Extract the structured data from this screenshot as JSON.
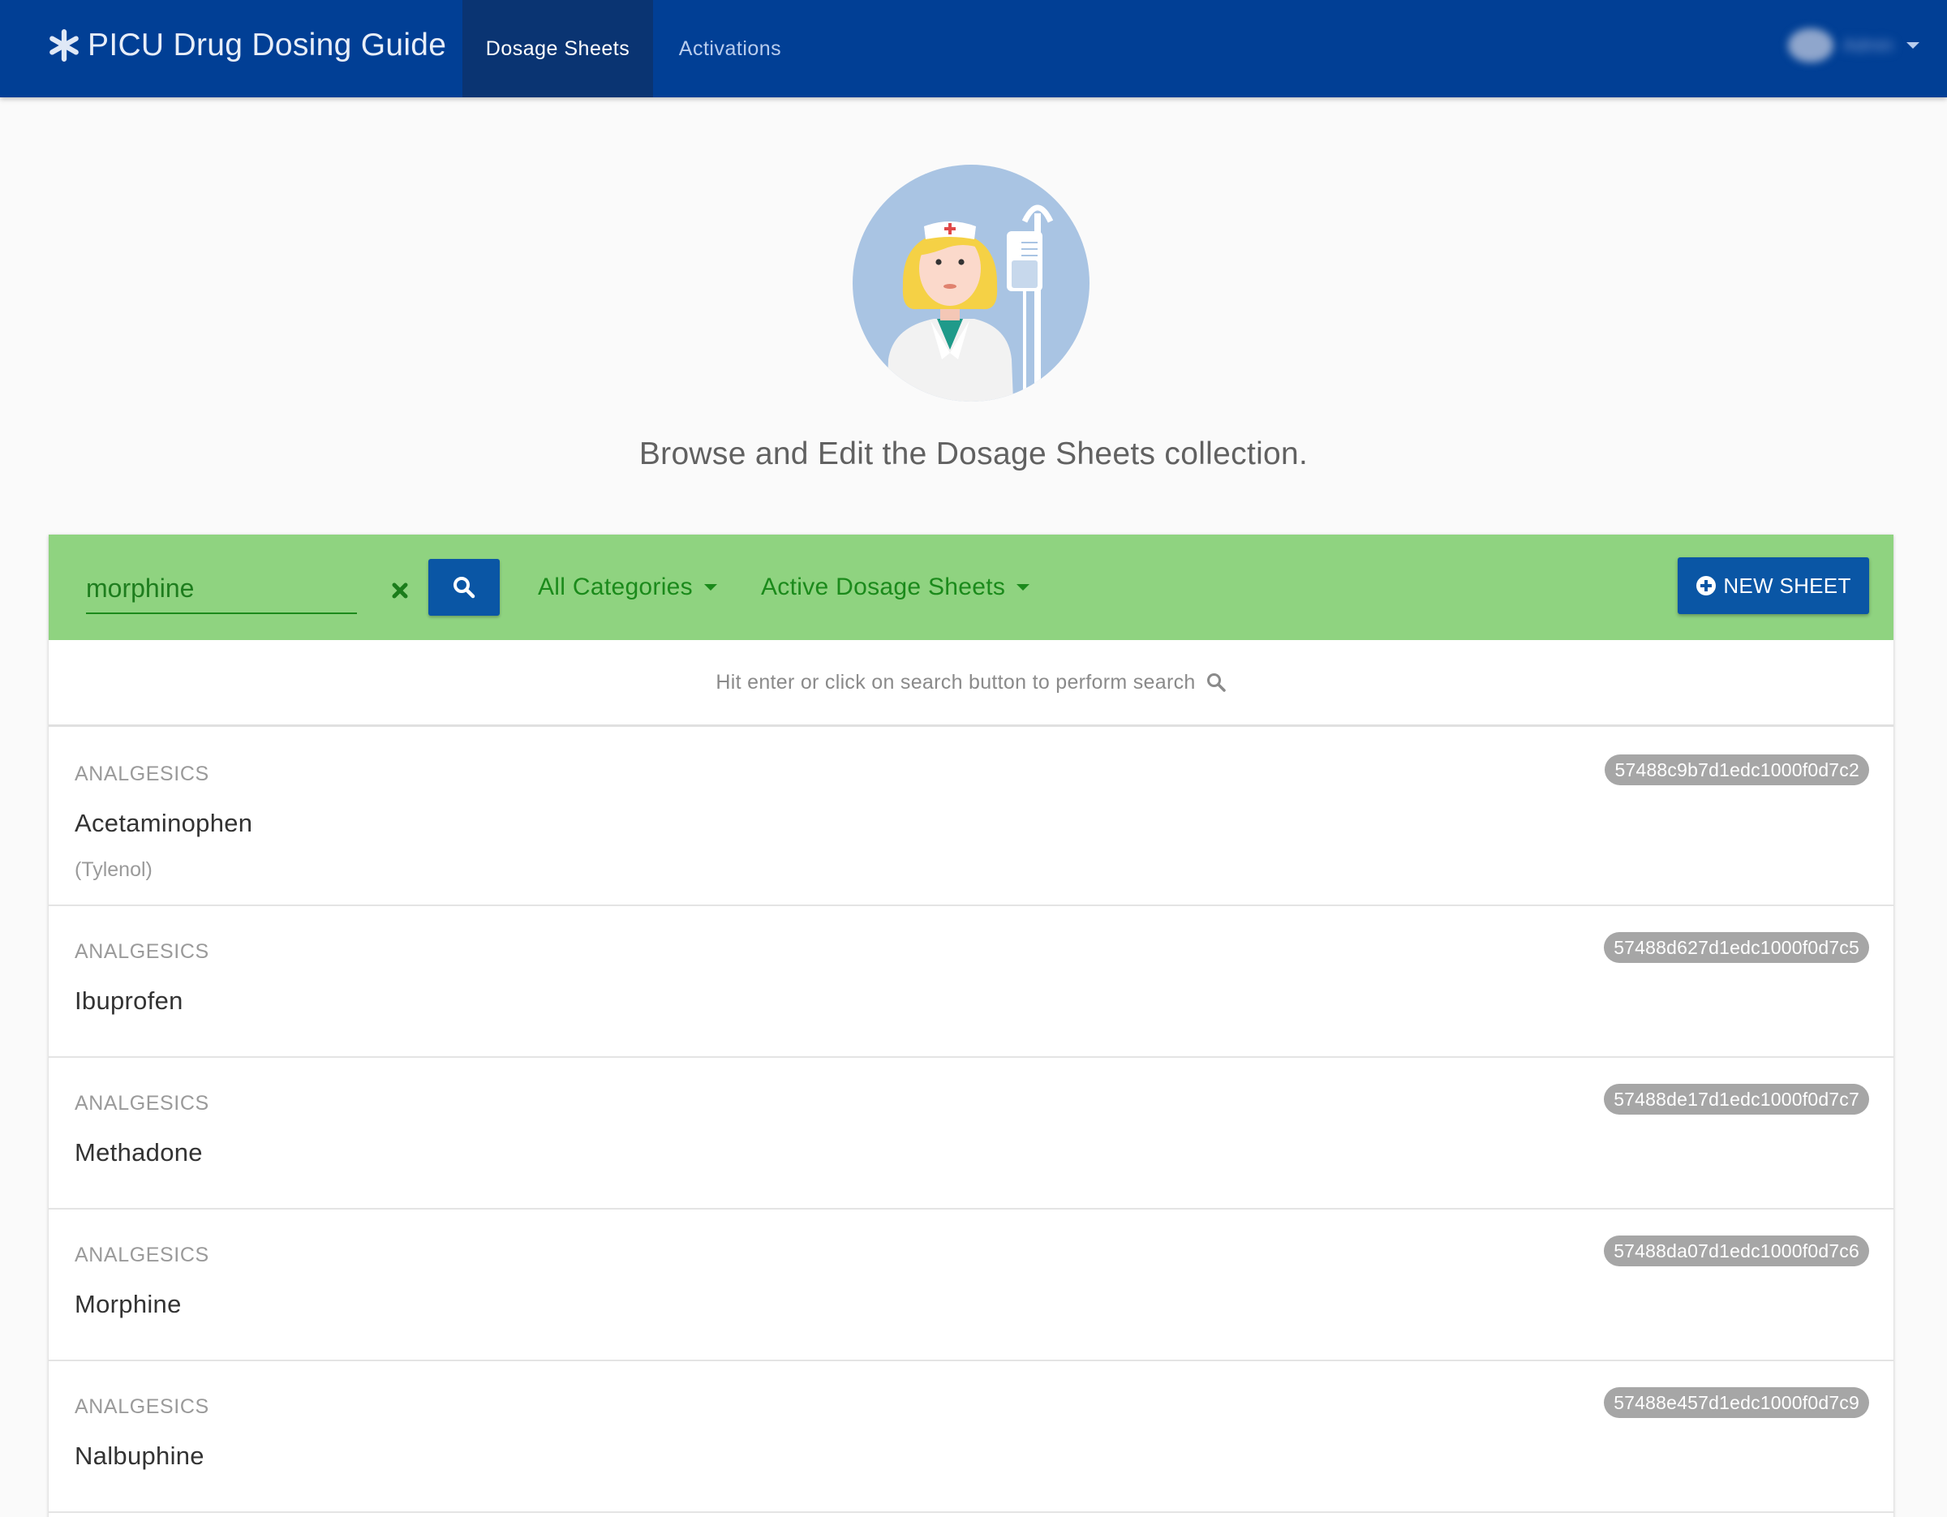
{
  "navbar": {
    "brand_title": "PICU Drug Dosing Guide",
    "brand_icon": "asterisk-icon",
    "tabs": [
      {
        "label": "Dosage Sheets",
        "active": true
      },
      {
        "label": "Activations",
        "active": false
      }
    ],
    "user": {
      "avatar_icon": "user-avatar",
      "name": "Admin"
    }
  },
  "hero": {
    "illustration": "nurse-with-iv-drip-avatar",
    "text": "Browse and Edit the Dosage Sheets collection."
  },
  "toolbar": {
    "search_value": "morphine",
    "clear_icon": "close-icon",
    "search_icon": "search-icon",
    "category_filter": "All Categories",
    "status_filter": "Active Dosage Sheets",
    "new_sheet_label": "NEW SHEET",
    "new_sheet_icon": "plus-circle-icon"
  },
  "hint": {
    "text": "Hit enter or click on search button to perform search",
    "icon": "search-icon"
  },
  "items": [
    {
      "category": "ANALGESICS",
      "name": "Acetaminophen",
      "alias": "(Tylenol)",
      "id": "57488c9b7d1edc1000f0d7c2"
    },
    {
      "category": "ANALGESICS",
      "name": "Ibuprofen",
      "alias": "",
      "id": "57488d627d1edc1000f0d7c5"
    },
    {
      "category": "ANALGESICS",
      "name": "Methadone",
      "alias": "",
      "id": "57488de17d1edc1000f0d7c7"
    },
    {
      "category": "ANALGESICS",
      "name": "Morphine",
      "alias": "",
      "id": "57488da07d1edc1000f0d7c6"
    },
    {
      "category": "ANALGESICS",
      "name": "Nalbuphine",
      "alias": "",
      "id": "57488e457d1edc1000f0d7c9"
    }
  ],
  "colors": {
    "navbar": "#013f95",
    "navbar_active_tab": "#0a3472",
    "toolbar": "#8fd380",
    "primary_button": "#0a56a5",
    "filter_text": "#1b8a1b",
    "id_badge": "#a6a6a6"
  }
}
